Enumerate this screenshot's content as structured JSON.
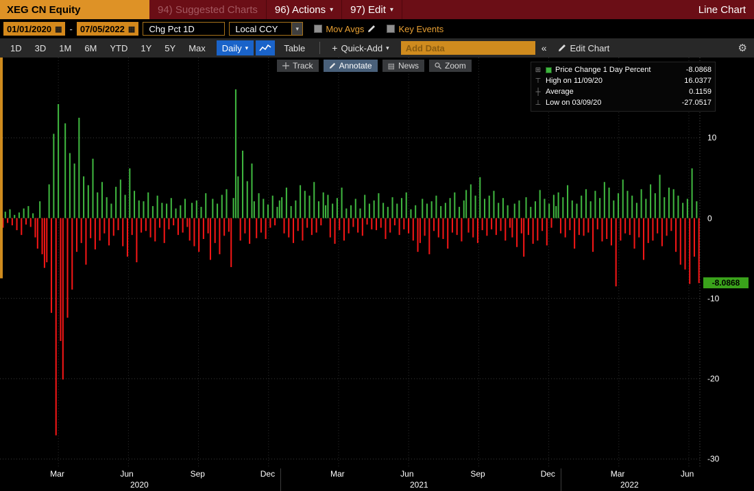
{
  "app": {
    "ticker": "XEG CN Equity",
    "suggested": "94) Suggested Charts",
    "actions": "96) Actions",
    "edit": "97) Edit",
    "right_label": "Line Chart"
  },
  "controls": {
    "date_from": "01/01/2020",
    "date_sep": "-",
    "date_to": "07/05/2022",
    "study": "Chg Pct 1D",
    "currency": "Local CCY",
    "mov_avgs": "Mov Avgs",
    "key_events": "Key Events"
  },
  "toolbar": {
    "ranges": [
      "1D",
      "3D",
      "1M",
      "6M",
      "YTD",
      "1Y",
      "5Y",
      "Max"
    ],
    "frequency": "Daily",
    "table": "Table",
    "quick_add": "Quick-Add",
    "add_data_placeholder": "Add Data",
    "collapse": "«",
    "edit_chart": "Edit Chart",
    "gear": "⚙"
  },
  "chart_tools": {
    "track": "Track",
    "annotate": "Annotate",
    "news": "News",
    "zoom": "Zoom"
  },
  "legend": {
    "series_label": "Price Change 1 Day Percent",
    "series_value": "-8.0868",
    "high_label": "High on 11/09/20",
    "high_value": "16.0377",
    "avg_label": "Average",
    "avg_value": "0.1159",
    "low_label": "Low on 03/09/20",
    "low_value": "-27.0517"
  },
  "axis": {
    "y_ticks": [
      10,
      0,
      -10,
      -20,
      -30
    ],
    "last_badge": "-8.0868",
    "months": [
      "Mar",
      "Jun",
      "Sep",
      "Dec",
      "Mar",
      "Jun",
      "Sep",
      "Dec",
      "Mar",
      "Jun"
    ],
    "years": [
      "2020",
      "2021",
      "2022"
    ]
  },
  "chart_data": {
    "type": "bar",
    "title": "XEG CN Equity - Price Change 1 Day Percent",
    "x_range": [
      "01/01/2020",
      "07/05/2022"
    ],
    "ylim": [
      -31,
      20
    ],
    "high": {
      "date": "11/09/20",
      "value": 16.0377
    },
    "low": {
      "date": "03/09/20",
      "value": -27.0517
    },
    "average": 0.1159,
    "last": -8.0868,
    "colors": {
      "up": "#3fb53f",
      "down": "#f21616",
      "accent_amber": "#cf8b1e",
      "badge_green": "#3aa21b"
    },
    "values": [
      0.5,
      -1.2,
      0.8,
      -0.6,
      1.1,
      -0.9,
      0.4,
      -1.5,
      0.7,
      -2.1,
      1.2,
      -0.8,
      1.5,
      -1.1,
      0.6,
      -2.4,
      -3.8,
      2.1,
      -4.5,
      -6.2,
      -5.5,
      4.2,
      -11.8,
      10.5,
      -27.0517,
      14.2,
      -15.3,
      -20.1,
      11.8,
      -12.4,
      8.1,
      -8.9,
      6.8,
      -4.2,
      12.5,
      -3.1,
      5.2,
      -5.8,
      4.1,
      -2.5,
      7.4,
      -3.9,
      3.2,
      -2.8,
      4.5,
      -1.9,
      2.6,
      -3.4,
      1.8,
      -2.2,
      3.9,
      -1.5,
      4.8,
      -3.5,
      2.9,
      -4.8,
      6.2,
      -2.1,
      3.4,
      -5.5,
      2.2,
      -1.8,
      2.1,
      -1.6,
      3.2,
      -2.4,
      1.5,
      -2.9,
      2.8,
      -1.2,
      1.9,
      -3.1,
      1.8,
      -1.4,
      2.5,
      -0.9,
      1.2,
      -2.1,
      1.6,
      -1.8,
      2.4,
      -1.1,
      -2.8,
      1.9,
      -3.5,
      2.2,
      -4.2,
      1.4,
      -2.6,
      3.1,
      -1.9,
      -5.2,
      2.4,
      -3.1,
      1.8,
      -4.5,
      2.9,
      -2.2,
      3.6,
      -1.7,
      -6.1,
      2.5,
      16.0377,
      5.2,
      -2.8,
      8.4,
      -1.9,
      4.6,
      -3.2,
      6.8,
      2.1,
      -2.5,
      3.1,
      -1.8,
      2.4,
      -2.6,
      1.7,
      -1.2,
      2.8,
      -0.9,
      1.4,
      2.2,
      2.6,
      -1.9,
      3.8,
      -2.4,
      1.5,
      -3.1,
      2.2,
      -1.6,
      4.1,
      -2.8,
      3.4,
      -1.2,
      2.8,
      -2.1,
      4.5,
      -1.8,
      2.1,
      -0.9,
      3.2,
      1.6,
      2.9,
      -2.4,
      1.8,
      -3.2,
      2.5,
      -1.5,
      3.8,
      -2.8,
      1.2,
      -1.9,
      1.6,
      -1.1,
      2.4,
      -1.8,
      1.2,
      -2.2,
      2.9,
      -0.8,
      1.8,
      -1.4,
      2.2,
      -1.5,
      3.1,
      -1.2,
      1.9,
      -2.6,
      1.4,
      -1.8,
      2.6,
      -0.9,
      1.8,
      -2.1,
      2.5,
      -1.4,
      3.2,
      -1.9,
      1.1,
      -2.8,
      1.6,
      -4.2,
      -3.1,
      2.4,
      -2.2,
      1.8,
      -4.5,
      2.1,
      -1.6,
      2.8,
      -2.4,
      1.5,
      -2.6,
      1.9,
      -3.8,
      2.5,
      -1.8,
      3.2,
      -2.1,
      1.4,
      -2.9,
      2.2,
      3.5,
      -1.8,
      4.2,
      -2.4,
      2.8,
      -3.1,
      5.1,
      -1.5,
      2.4,
      -2.2,
      2.8,
      -1.4,
      3.4,
      -2.1,
      1.9,
      -1.6,
      2.5,
      -2.8,
      1.6,
      -1.2,
      -2.4,
      1.8,
      -3.6,
      2.2,
      -1.9,
      -4.8,
      2.6,
      -2.1,
      1.4,
      -3.2,
      2.1,
      -2.8,
      3.5,
      -1.6,
      2.4,
      -3.4,
      1.8,
      -1.2,
      2.9,
      1.5,
      3.2,
      -1.9,
      2.6,
      -2.4,
      4.1,
      -1.5,
      2.2,
      -3.8,
      1.8,
      -2.1,
      2.8,
      -2.2,
      3.6,
      -1.8,
      2.1,
      -4.2,
      3.4,
      -1.4,
      2.5,
      -2.9,
      4.5,
      -2.6,
      3.8,
      -3.4,
      2.2,
      -8.5,
      3.1,
      -2.8,
      4.8,
      -1.9,
      3.4,
      -2.1,
      2.8,
      -3.8,
      1.9,
      -2.4,
      3.6,
      -5.2,
      2.4,
      -3.1,
      4.2,
      -2.8,
      3.1,
      -1.9,
      5.4,
      -3.5,
      2.6,
      -2.2,
      3.8,
      -1.6,
      3.6,
      -4.2,
      2.8,
      -5.8,
      1.9,
      -6.4,
      2.4,
      -8.2,
      6.2,
      -4.8,
      2.1,
      -8.0868
    ]
  }
}
